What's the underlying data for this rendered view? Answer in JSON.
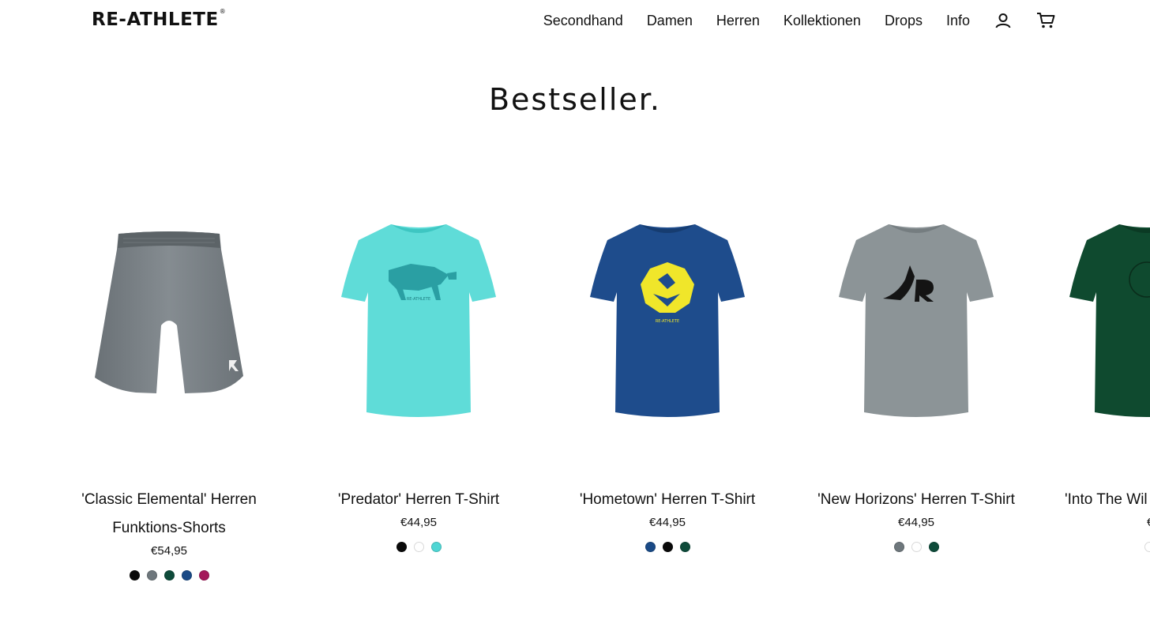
{
  "header": {
    "logo": "RE-ATHLETE",
    "logo_mark": "®",
    "nav": [
      "Secondhand",
      "Damen",
      "Herren",
      "Kollektionen",
      "Drops",
      "Info"
    ],
    "icons": [
      "account-icon",
      "cart-icon"
    ]
  },
  "section": {
    "title": "Bestseller."
  },
  "products": [
    {
      "name": "'Classic Elemental' Herren Funktions-Shorts",
      "price": "€54,95",
      "image": "grey-shorts",
      "swatches": [
        "#0a0a0a",
        "#6e777c",
        "#0e4b3a",
        "#1a4a86",
        "#a4185a"
      ]
    },
    {
      "name": "'Predator' Herren T-Shirt",
      "price": "€44,95",
      "image": "turquoise-tshirt-bear",
      "swatches": [
        "#0a0a0a",
        "#ffffff",
        "#4fd6d4"
      ]
    },
    {
      "name": "'Hometown' Herren T-Shirt",
      "price": "€44,95",
      "image": "blue-tshirt-lion",
      "swatches": [
        "#1a4a86",
        "#0a0a0a",
        "#0e4b3a"
      ]
    },
    {
      "name": "'New Horizons' Herren T-Shirt",
      "price": "€44,95",
      "image": "grey-tshirt-eagle",
      "swatches": [
        "#6e777c",
        "#ffffff",
        "#0e4b3a"
      ]
    },
    {
      "name": "'Into The Wil",
      "price": "€",
      "image": "green-tshirt",
      "swatches": [
        "#ffffff"
      ]
    }
  ]
}
